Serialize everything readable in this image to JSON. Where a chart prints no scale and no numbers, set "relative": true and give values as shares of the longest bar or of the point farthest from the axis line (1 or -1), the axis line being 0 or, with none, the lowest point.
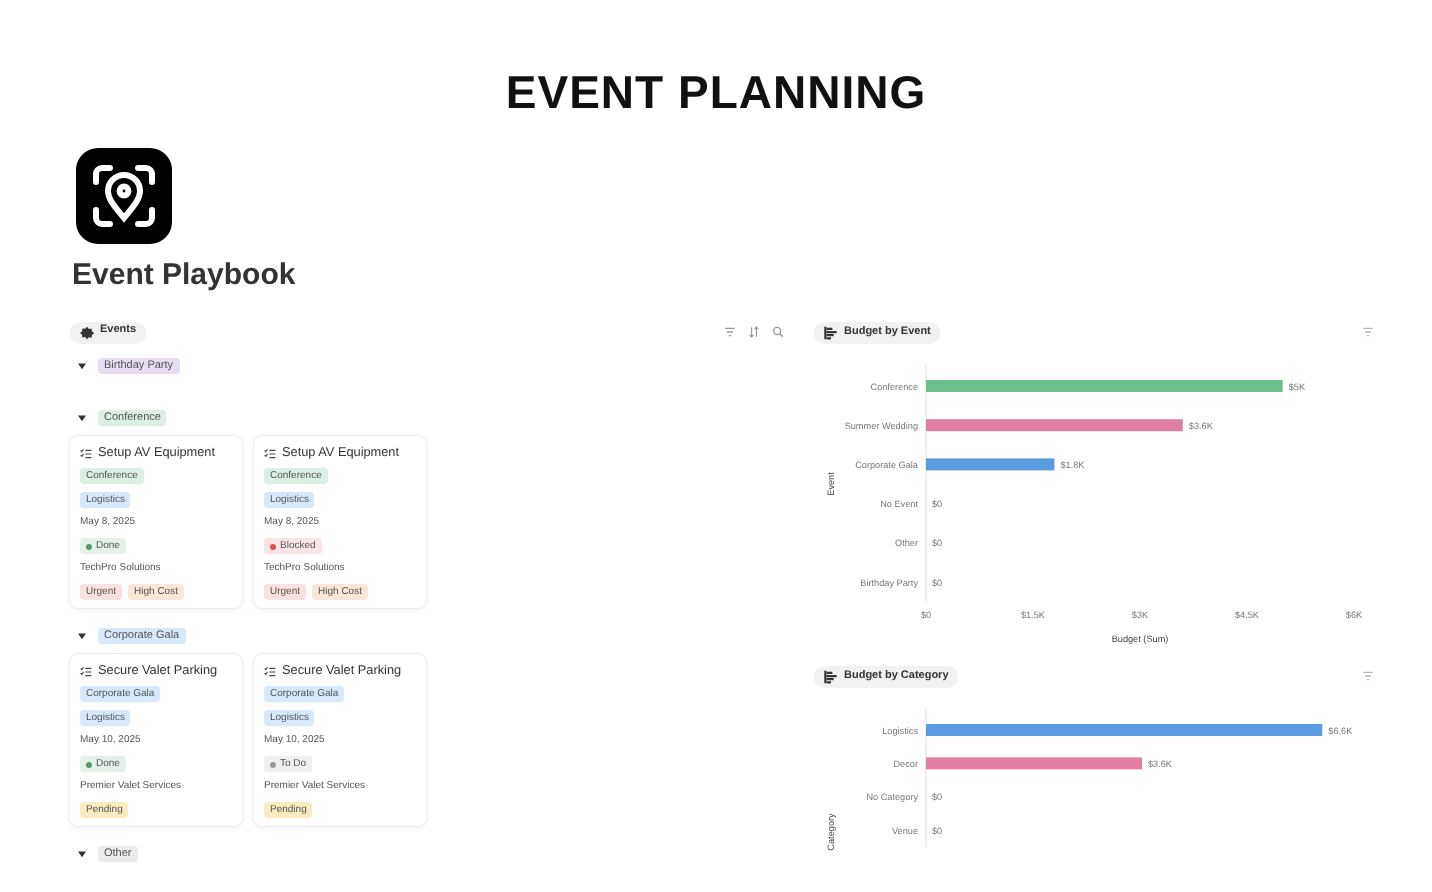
{
  "banner": {
    "title": "EVENT PLANNING"
  },
  "page": {
    "title": "Event Playbook"
  },
  "board": {
    "view_label": "Events",
    "groups": [
      {
        "label": "Birthday Party",
        "color": "#e8dcf2",
        "expanded": true
      },
      {
        "label": "Conference",
        "color": "#dcefe3",
        "expanded": true,
        "cards": [
          {
            "title": "Setup AV Equipment",
            "event": {
              "label": "Conference",
              "color": "#dcefe3"
            },
            "category": {
              "label": "Logistics",
              "color": "#d6e8fa"
            },
            "date": "May 8, 2025",
            "status": {
              "label": "Done",
              "color": "#4f9a6a"
            },
            "vendor": "TechPro Solutions",
            "tags": [
              {
                "label": "Urgent",
                "color": "#fbe0e0"
              },
              {
                "label": "High Cost",
                "color": "#f8e6d6"
              }
            ]
          },
          {
            "title": "Setup AV Equipment",
            "event": {
              "label": "Conference",
              "color": "#dcefe3"
            },
            "category": {
              "label": "Logistics",
              "color": "#d6e8fa"
            },
            "date": "May 8, 2025",
            "status": {
              "label": "Blocked",
              "color": "#d9534f"
            },
            "vendor": "TechPro Solutions",
            "tags": [
              {
                "label": "Urgent",
                "color": "#fbe0e0"
              },
              {
                "label": "High Cost",
                "color": "#f8e6d6"
              }
            ]
          }
        ]
      },
      {
        "label": "Corporate Gala",
        "color": "#d6e8fa",
        "expanded": true,
        "cards": [
          {
            "title": "Secure Valet Parking",
            "event": {
              "label": "Corporate Gala",
              "color": "#d6e8fa"
            },
            "category": {
              "label": "Logistics",
              "color": "#d6e8fa"
            },
            "date": "May 10, 2025",
            "status": {
              "label": "Done",
              "color": "#4f9a6a"
            },
            "vendor": "Premier Valet Services",
            "tags": [
              {
                "label": "Pending",
                "color": "#f8ecc0"
              }
            ]
          },
          {
            "title": "Secure Valet Parking",
            "event": {
              "label": "Corporate Gala",
              "color": "#d6e8fa"
            },
            "category": {
              "label": "Logistics",
              "color": "#d6e8fa"
            },
            "date": "May 10, 2025",
            "status": {
              "label": "To Do",
              "color": "#9a9a9a"
            },
            "vendor": "Premier Valet Services",
            "tags": [
              {
                "label": "Pending",
                "color": "#f8ecc0"
              }
            ]
          }
        ]
      },
      {
        "label": "Other",
        "color": "#ececec",
        "expanded": true
      }
    ]
  },
  "charts": [
    {
      "chart_data": {
        "type": "bar",
        "orientation": "horizontal",
        "title": "Budget by Event",
        "xlabel": "Budget (Sum)",
        "ylabel": "Event",
        "categories": [
          "Conference",
          "Summer Wedding",
          "Corporate Gala",
          "No Event",
          "Other",
          "Birthday Party"
        ],
        "series": [
          {
            "values": [
              5000,
              3600,
              1800,
              0,
              0,
              0
            ]
          }
        ],
        "colors": [
          "#6dbf8b",
          "#e07fa3",
          "#5a9be0"
        ],
        "value_labels": [
          "$5K",
          "$3.6K",
          "$1.8K",
          "$0",
          "$0",
          "$0"
        ],
        "xlim": [
          0,
          6000
        ],
        "xticks": [
          {
            "value": 0,
            "label": "$0"
          },
          {
            "value": 1500,
            "label": "$1.5K"
          },
          {
            "value": 3000,
            "label": "$3K"
          },
          {
            "value": 4500,
            "label": "$4.5K"
          },
          {
            "value": 6000,
            "label": "$6K"
          }
        ]
      }
    },
    {
      "chart_data": {
        "type": "bar",
        "orientation": "horizontal",
        "title": "Budget by Category",
        "ylabel": "Category",
        "categories": [
          "Logistics",
          "Decor",
          "No Category",
          "Venue"
        ],
        "series": [
          {
            "values": [
              1,
              0.545,
              0,
              0
            ]
          }
        ],
        "colors": [
          "#5a9be0",
          "#e07fa3"
        ],
        "relative": true,
        "value_labels": [
          "$6.6K",
          "$3.6K",
          "$0",
          "$0"
        ]
      }
    }
  ]
}
